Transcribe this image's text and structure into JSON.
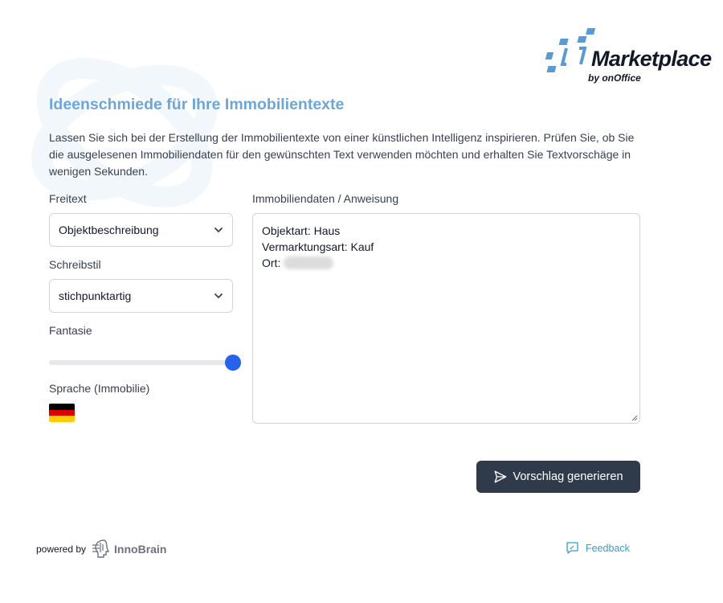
{
  "brand": {
    "wordmark": "Marketplace",
    "byline": "by onOffice",
    "accent_color": "#6ea6d6"
  },
  "header": {
    "title": "Ideenschmiede für Ihre Immobilientexte",
    "intro": "Lassen Sie sich bei der Erstellung der Immobilientexte von einer künstlichen Intelligenz inspirieren. Prüfen Sie, ob Sie die ausgelesenen Immobiliendaten für den gewünschten Text verwenden möchten und erhalten Sie Textvorschäge in wenigen Sekunden."
  },
  "form": {
    "freitext": {
      "label": "Freitext",
      "value": "Objektbeschreibung",
      "icon": "chevron-down-icon"
    },
    "schreibstil": {
      "label": "Schreibstil",
      "value": "stichpunktartig",
      "icon": "chevron-down-icon"
    },
    "fantasie": {
      "label": "Fantasie",
      "value": 1.0
    },
    "sprache": {
      "label": "Sprache (Immobilie)",
      "flag": "german-flag-icon",
      "colors": [
        "#000000",
        "#dd0000",
        "#ffce00"
      ]
    },
    "daten": {
      "label": "Immobiliendaten / Anweisung",
      "lines": [
        "Objektart: Haus",
        "Vermarktungsart: Kauf",
        "Ort:"
      ]
    }
  },
  "actions": {
    "generate_label": "Vorschlag generieren",
    "generate_icon": "send-icon",
    "button_color": "#2f3a4b"
  },
  "footer": {
    "powered_by": "powered by",
    "partner": "InnoBrain",
    "partner_icon": "innobrain-logo-icon",
    "feedback_label": "Feedback",
    "feedback_icon": "feedback-icon"
  }
}
